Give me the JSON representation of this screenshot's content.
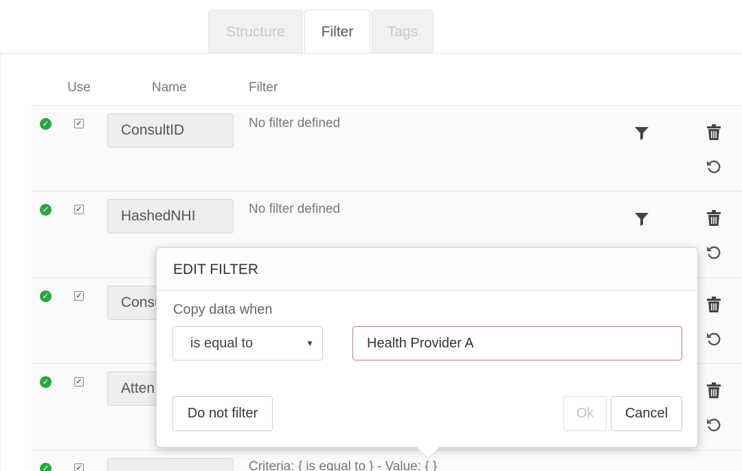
{
  "tabs": [
    {
      "label": "Structure",
      "active": false
    },
    {
      "label": "Filter",
      "active": true
    },
    {
      "label": "Tags",
      "active": false
    }
  ],
  "columns": {
    "use": "Use",
    "name": "Name",
    "filter": "Filter"
  },
  "rows": [
    {
      "name": "ConsultID",
      "filter_text": "No filter defined",
      "use": true,
      "status": "ok"
    },
    {
      "name": "HashedNHI",
      "filter_text": "No filter defined",
      "use": true,
      "status": "ok"
    },
    {
      "name": "Consu",
      "filter_text": "",
      "use": true,
      "status": "ok"
    },
    {
      "name": "Atten",
      "filter_text": "",
      "use": true,
      "status": "ok"
    },
    {
      "name": "",
      "filter_text": "Criteria: { is equal to } - Value: { }",
      "use": true,
      "status": "ok"
    }
  ],
  "dialog": {
    "title": "EDIT FILTER",
    "copy_label": "Copy data when",
    "operator_selected": "is equal to",
    "value": "Health Provider A",
    "no_filter_label": "Do not filter",
    "ok_label": "Ok",
    "cancel_label": "Cancel"
  },
  "icons": {
    "status": "check-circle-icon",
    "filter": "funnel-icon",
    "delete": "trash-icon",
    "revert": "undo-icon"
  },
  "colors": {
    "status_ok": "#28a745",
    "input_invalid_border": "#c9796f",
    "tab_inactive_text": "#c9c9c9"
  }
}
